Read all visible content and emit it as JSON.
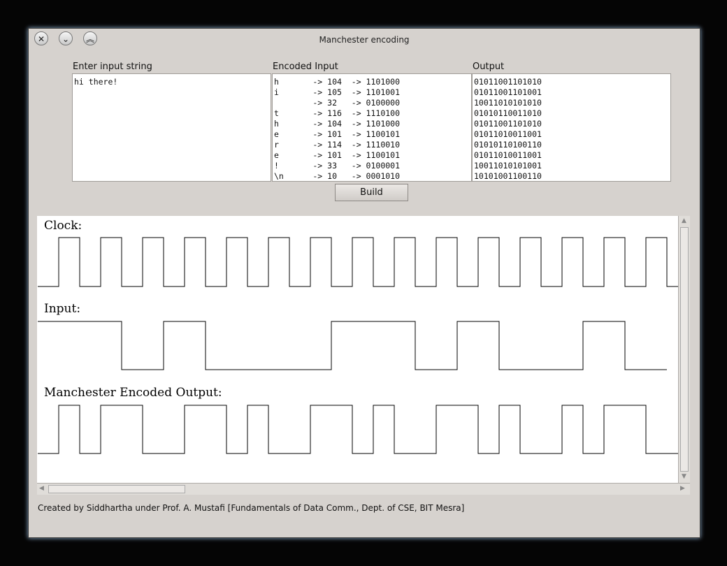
{
  "window": {
    "title": "Manchester encoding"
  },
  "input_section": {
    "label": "Enter input string",
    "value": "hi there!"
  },
  "encoded_section": {
    "label": "Encoded Input",
    "rows": [
      "h       -> 104  -> 1101000",
      "i       -> 105  -> 1101001",
      "        -> 32   -> 0100000",
      "t       -> 116  -> 1110100",
      "h       -> 104  -> 1101000",
      "e       -> 101  -> 1100101",
      "r       -> 114  -> 1110010",
      "e       -> 101  -> 1100101",
      "!       -> 33   -> 0100001",
      "\\n      -> 10   -> 0001010"
    ]
  },
  "output_section": {
    "label": "Output",
    "rows": [
      "01011001101010",
      "01011001101001",
      "10011010101010",
      "01010110011010",
      "01011001101010",
      "01011010011001",
      "01010110100110",
      "01011010011001",
      "10011010101001",
      "10101001100110"
    ]
  },
  "build_button": {
    "label": "Build"
  },
  "signals": {
    "clock_label": "Clock:",
    "input_label": "Input:",
    "manchester_label": "Manchester Encoded Output:",
    "input_bits": [
      1,
      1,
      0,
      1,
      0,
      0,
      0,
      1,
      1,
      0,
      1,
      0,
      0,
      1,
      0
    ],
    "manchester_halfbits": [
      0,
      1,
      0,
      1,
      1,
      0,
      0,
      1,
      1,
      0,
      1,
      0,
      0,
      1,
      1,
      0,
      1,
      0,
      0,
      1,
      1,
      0,
      1,
      0,
      0,
      1,
      0,
      1,
      1,
      0,
      0
    ]
  },
  "colors": {
    "window_bg": "#d6d2ce",
    "canvas_bg": "#ffffff",
    "trace": "#000000"
  },
  "footer": {
    "text": "Created by Siddhartha under Prof. A. Mustafi [Fundamentals of Data Comm., Dept. of CSE, BIT Mesra]"
  }
}
